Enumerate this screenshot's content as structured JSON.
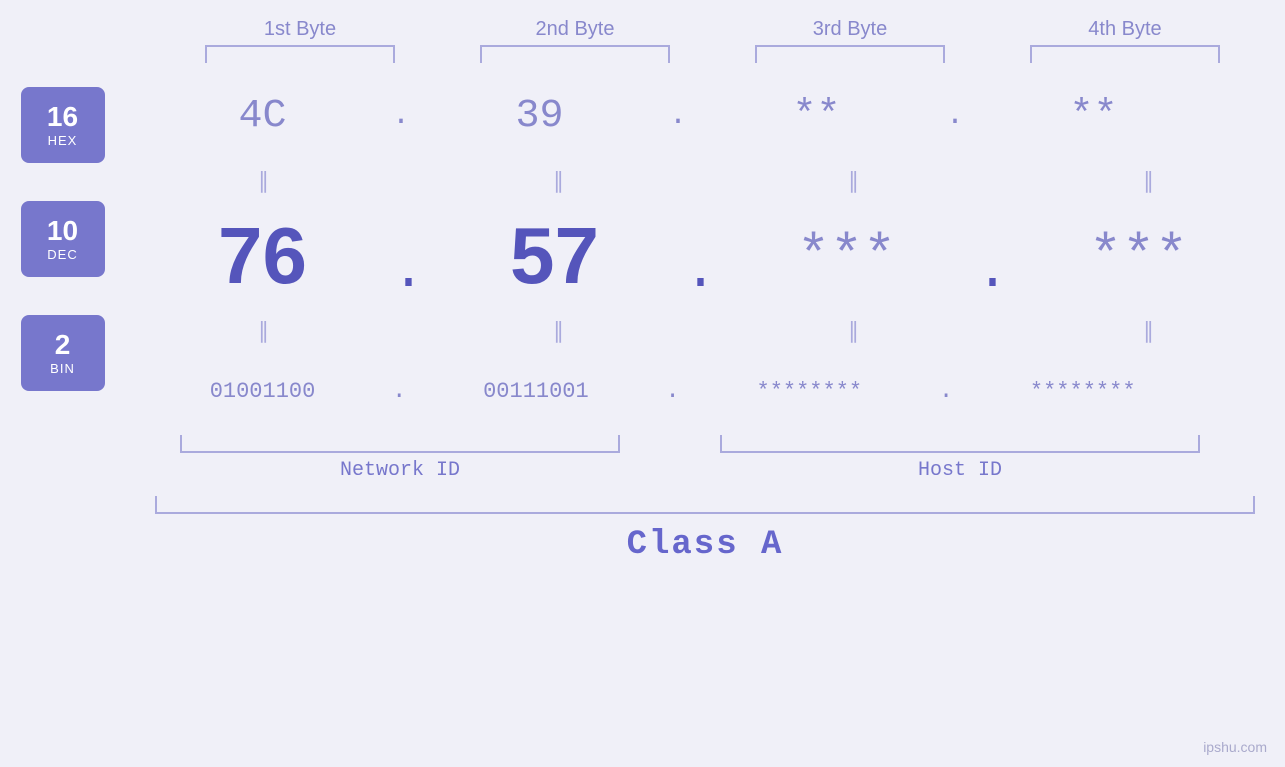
{
  "headers": {
    "byte1": "1st Byte",
    "byte2": "2nd Byte",
    "byte3": "3rd Byte",
    "byte4": "4th Byte"
  },
  "bases": {
    "hex": {
      "num": "16",
      "label": "HEX"
    },
    "dec": {
      "num": "10",
      "label": "DEC"
    },
    "bin": {
      "num": "2",
      "label": "BIN"
    }
  },
  "values": {
    "hex": {
      "b1": "4C",
      "b2": "39",
      "b3": "**",
      "b4": "**",
      "eq": "||"
    },
    "dec": {
      "b1": "76",
      "b2": "57",
      "b3": "***",
      "b4": "***",
      "eq": "||"
    },
    "bin": {
      "b1": "01001100",
      "b2": "00111001",
      "b3": "********",
      "b4": "********",
      "eq": "||"
    }
  },
  "labels": {
    "network_id": "Network ID",
    "host_id": "Host ID",
    "class": "Class A"
  },
  "watermark": "ipshu.com"
}
